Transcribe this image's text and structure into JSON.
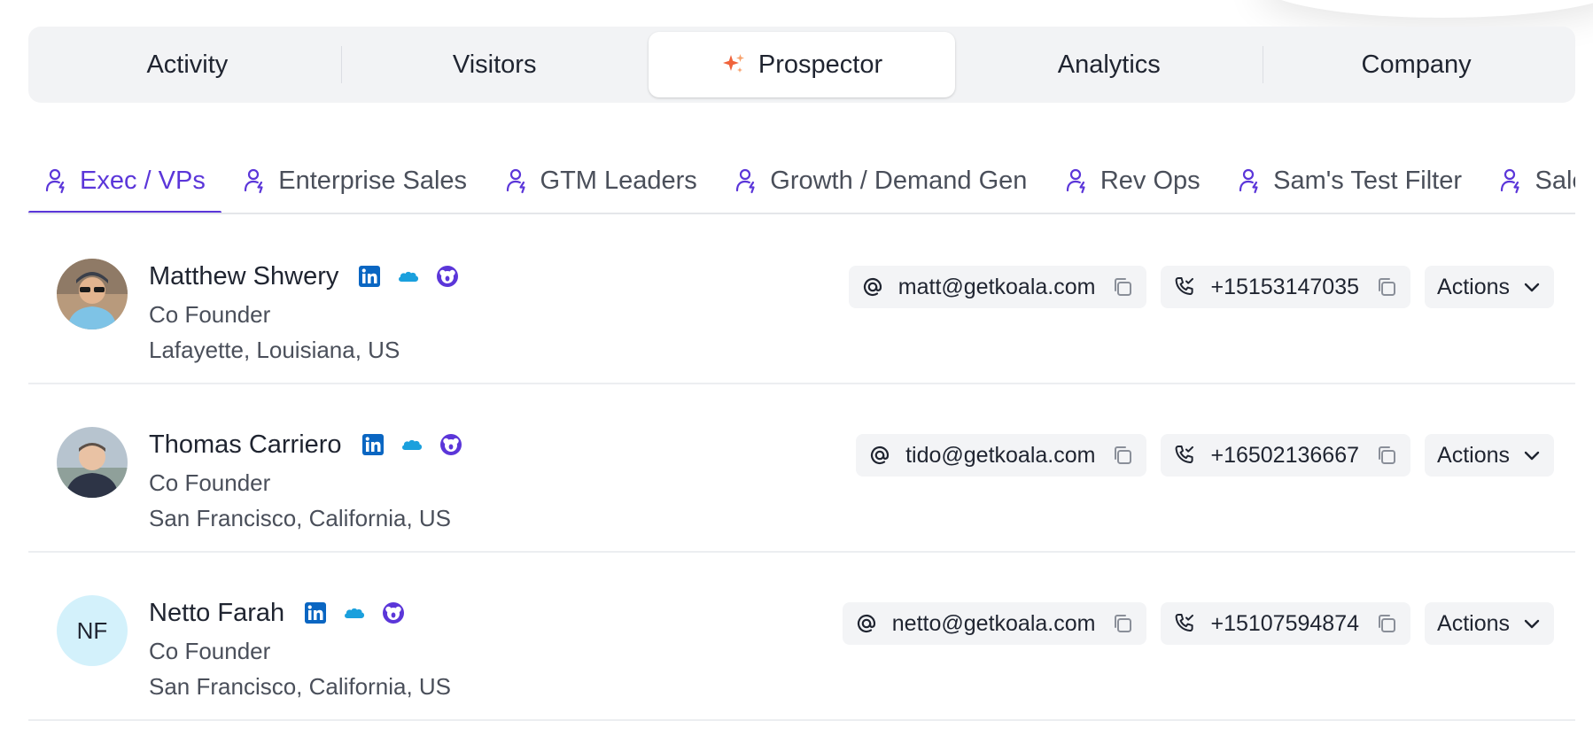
{
  "topnav": {
    "items": [
      {
        "label": "Activity",
        "active": false
      },
      {
        "label": "Visitors",
        "active": false
      },
      {
        "label": "Prospector",
        "active": true,
        "icon": "sparkle-icon"
      },
      {
        "label": "Analytics",
        "active": false
      },
      {
        "label": "Company",
        "active": false
      }
    ]
  },
  "filters": {
    "tabs": [
      {
        "label": "Exec / VPs",
        "active": true
      },
      {
        "label": "Enterprise Sales",
        "active": false
      },
      {
        "label": "GTM Leaders",
        "active": false
      },
      {
        "label": "Growth / Demand Gen",
        "active": false
      },
      {
        "label": "Rev Ops",
        "active": false
      },
      {
        "label": "Sam's Test Filter",
        "active": false
      },
      {
        "label": "Sales",
        "active": false
      }
    ]
  },
  "people": [
    {
      "name": "Matthew Shwery",
      "title": "Co Founder",
      "location": "Lafayette, Louisiana, US",
      "email": "matt@getkoala.com",
      "phone": "+15153147035",
      "avatar": "photo",
      "actions_label": "Actions"
    },
    {
      "name": "Thomas Carriero",
      "title": "Co Founder",
      "location": "San Francisco, California, US",
      "email": "tido@getkoala.com",
      "phone": "+16502136667",
      "avatar": "photo",
      "actions_label": "Actions"
    },
    {
      "name": "Netto Farah",
      "title": "Co Founder",
      "location": "San Francisco, California, US",
      "email": "netto@getkoala.com",
      "phone": "+15107594874",
      "avatar": "initials",
      "initials": "NF",
      "actions_label": "Actions"
    }
  ],
  "colors": {
    "accent": "#5b36d9",
    "linkedin": "#0a66c2",
    "salesforce": "#1ba0dd",
    "koala": "#5b36d9",
    "sparkle": "#f0643c"
  }
}
